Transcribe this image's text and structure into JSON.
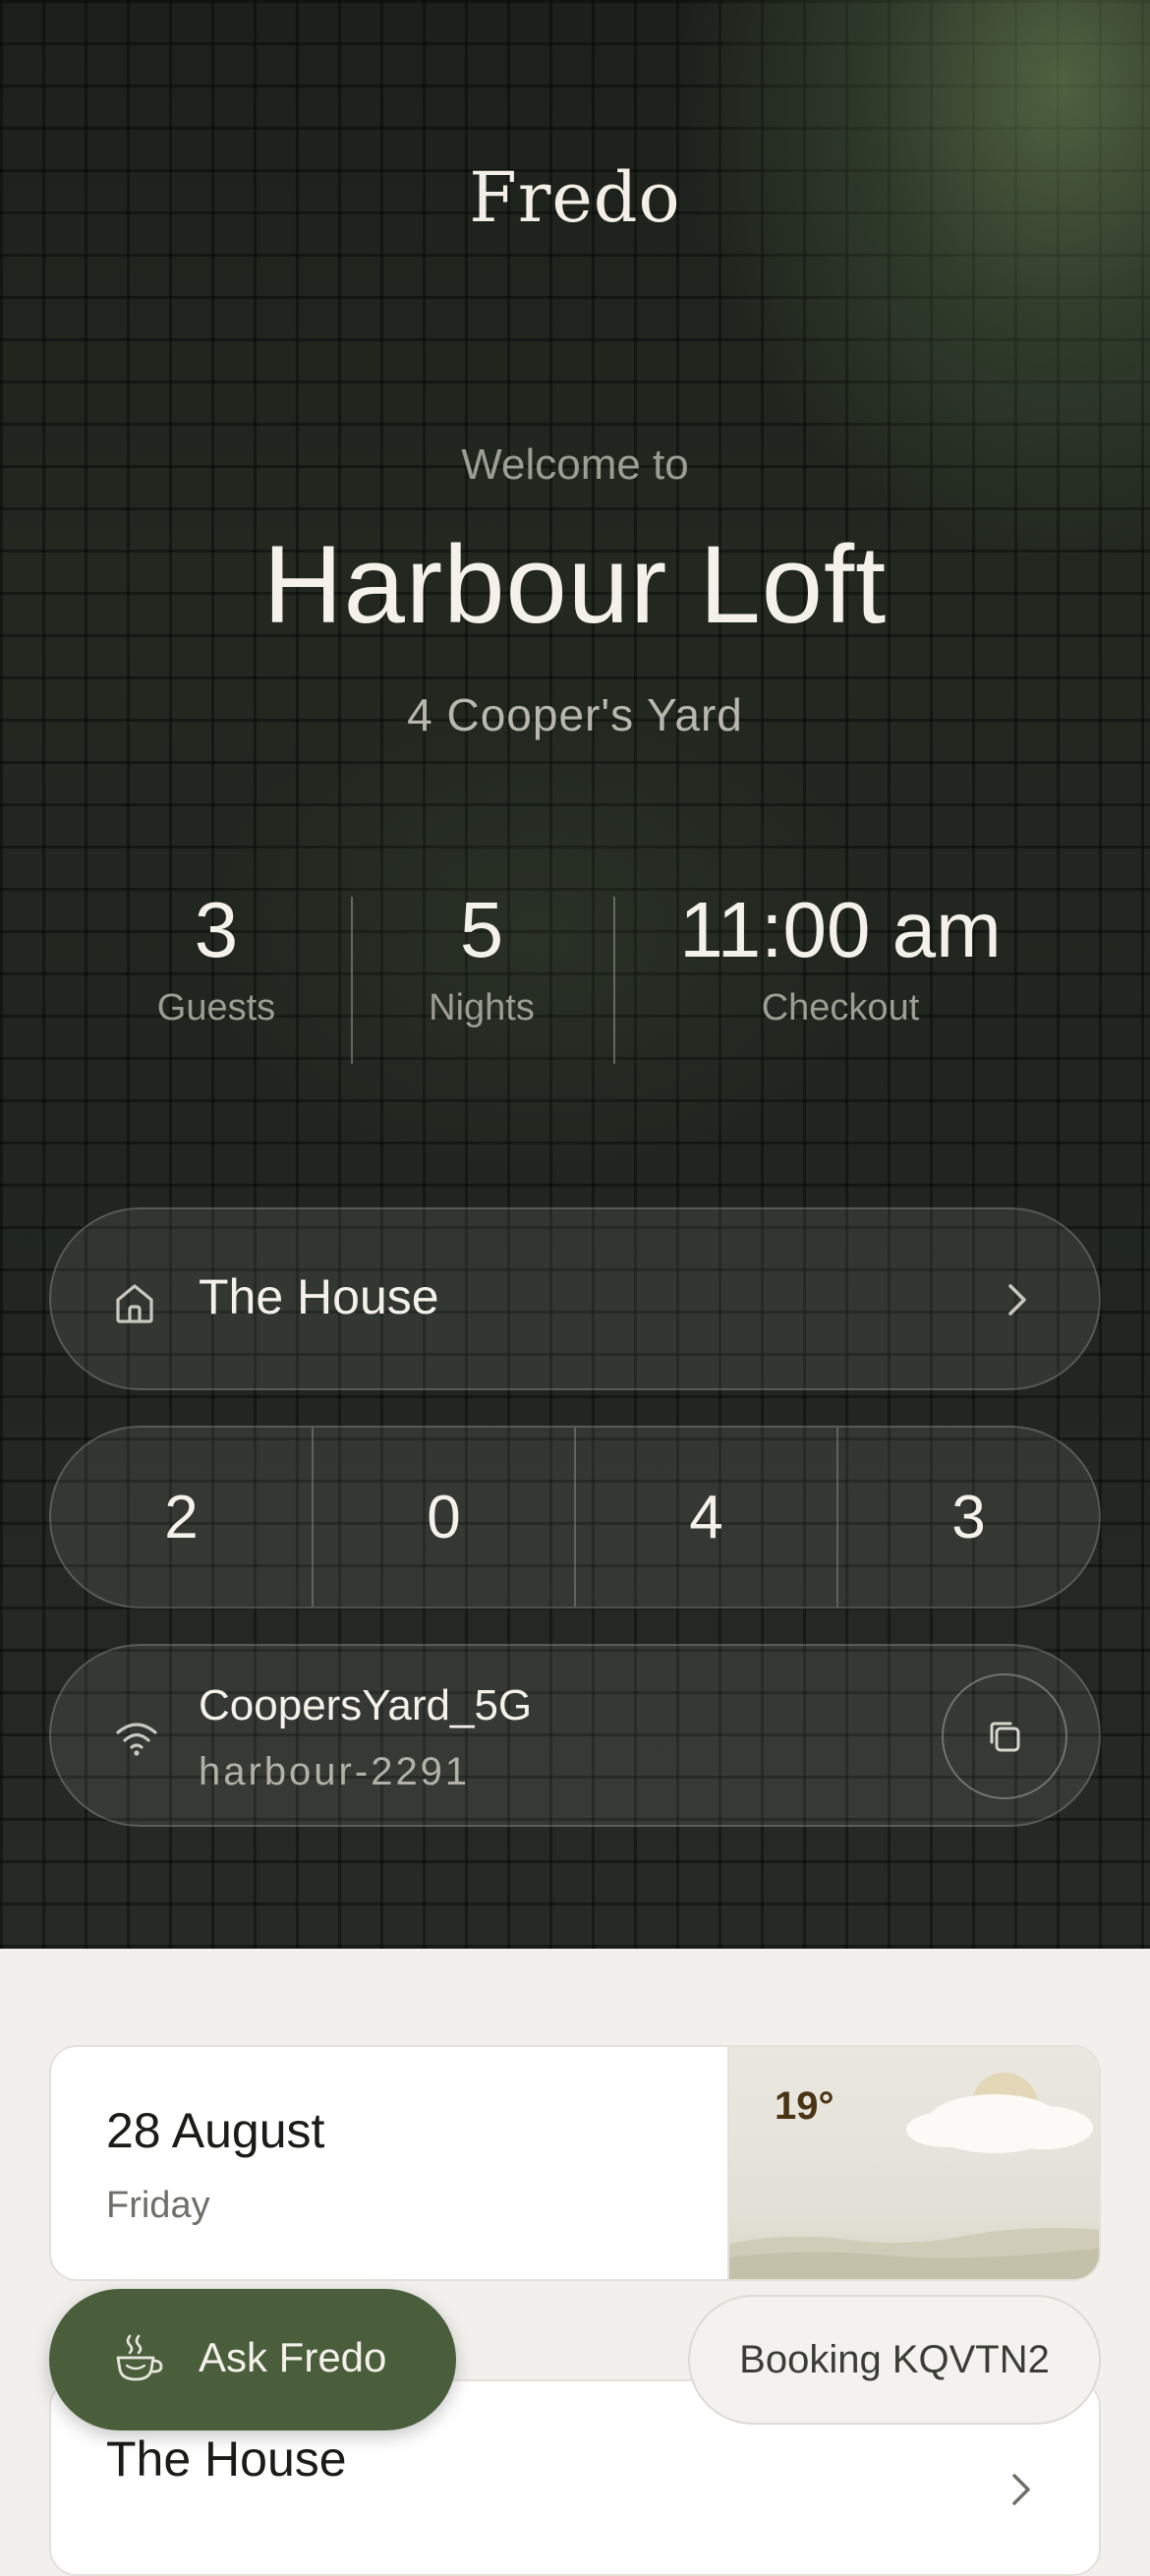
{
  "brand": "Fredo",
  "welcome": {
    "intro": "Welcome to",
    "property_name": "Harbour Loft",
    "address": "4 Cooper's Yard"
  },
  "stats": [
    {
      "value": "3",
      "label": "Guests"
    },
    {
      "value": "5",
      "label": "Nights"
    },
    {
      "value": "11:00 am",
      "label": "Checkout"
    }
  ],
  "house_link": {
    "label": "The House",
    "icon": "house-icon"
  },
  "door_code": [
    "2",
    "0",
    "4",
    "3"
  ],
  "wifi": {
    "ssid": "CoopersYard_5G",
    "password": "harbour-2291",
    "copy_icon": "copy-icon"
  },
  "date_card": {
    "date": "28 August",
    "weekday": "Friday",
    "temperature": "19°",
    "weather_icon": "partly-cloudy"
  },
  "house_card": {
    "title": "The House"
  },
  "ask_button": {
    "label": "Ask Fredo",
    "icon": "coffee-cup-icon"
  },
  "booking": {
    "label": "Booking KQVTN2"
  },
  "colors": {
    "accent": "#4a5e3c",
    "hero_bg": "#1f241e",
    "page_bg": "#f1f0ec"
  }
}
